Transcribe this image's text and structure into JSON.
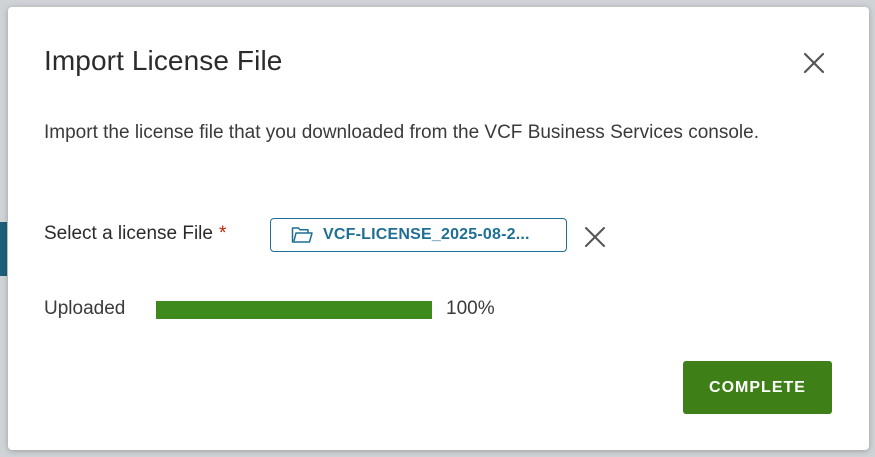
{
  "dialog": {
    "title": "Import License File",
    "description": "Import the license file that you downloaded from the VCF Business Services console.",
    "file_field": {
      "label": "Select a license File",
      "required_marker": "*",
      "file_name": "VCF-LICENSE_2025-08-2..."
    },
    "upload": {
      "label": "Uploaded",
      "progress": 1.0,
      "percent_text": "100%"
    },
    "complete_label": "COMPLETE",
    "icons": {
      "close": "close-icon",
      "folder": "folder-icon",
      "remove": "remove-file-icon"
    },
    "colors": {
      "accent": "#1f6f95",
      "progress": "#3f8a1c",
      "primary_button": "#3f7f17",
      "required": "#c92100"
    }
  }
}
